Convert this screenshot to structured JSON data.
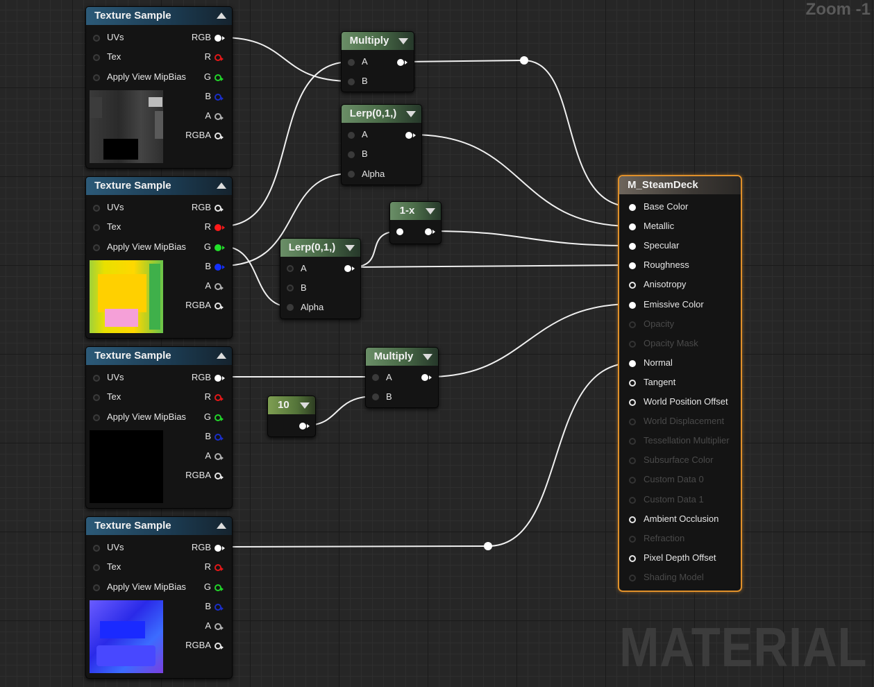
{
  "zoom_label": "Zoom -1",
  "watermark": "MATERIAL",
  "texture_nodes": [
    {
      "title": "Texture Sample",
      "inputs": [
        "UVs",
        "Tex",
        "Apply View MipBias"
      ],
      "outputs": [
        "RGB",
        "R",
        "G",
        "B",
        "A",
        "RGBA"
      ],
      "preview": "dark-gray-mask"
    },
    {
      "title": "Texture Sample",
      "inputs": [
        "UVs",
        "Tex",
        "Apply View MipBias"
      ],
      "outputs": [
        "RGB",
        "R",
        "G",
        "B",
        "A",
        "RGBA"
      ],
      "preview": "yellow-green-mask"
    },
    {
      "title": "Texture Sample",
      "inputs": [
        "UVs",
        "Tex",
        "Apply View MipBias"
      ],
      "outputs": [
        "RGB",
        "R",
        "G",
        "B",
        "A",
        "RGBA"
      ],
      "preview": "black"
    },
    {
      "title": "Texture Sample",
      "inputs": [
        "UVs",
        "Tex",
        "Apply View MipBias"
      ],
      "outputs": [
        "RGB",
        "R",
        "G",
        "B",
        "A",
        "RGBA"
      ],
      "preview": "blue-normal-map"
    }
  ],
  "multiply1": {
    "title": "Multiply",
    "inputs": [
      "A",
      "B"
    ]
  },
  "lerp1": {
    "title": "Lerp(0,1,)",
    "inputs": [
      "A",
      "B",
      "Alpha"
    ]
  },
  "one_minus": {
    "title": "1-x"
  },
  "lerp2": {
    "title": "Lerp(0,1,)",
    "inputs": [
      "A",
      "B",
      "Alpha"
    ]
  },
  "multiply2": {
    "title": "Multiply",
    "inputs": [
      "A",
      "B"
    ]
  },
  "constant": {
    "title": "10"
  },
  "material_node": {
    "title": "M_SteamDeck",
    "inputs": [
      {
        "label": "Base Color",
        "state": "connected"
      },
      {
        "label": "Metallic",
        "state": "connected"
      },
      {
        "label": "Specular",
        "state": "connected"
      },
      {
        "label": "Roughness",
        "state": "connected"
      },
      {
        "label": "Anisotropy",
        "state": "enabled"
      },
      {
        "label": "Emissive Color",
        "state": "connected"
      },
      {
        "label": "Opacity",
        "state": "disabled"
      },
      {
        "label": "Opacity Mask",
        "state": "disabled"
      },
      {
        "label": "Normal",
        "state": "connected"
      },
      {
        "label": "Tangent",
        "state": "enabled"
      },
      {
        "label": "World Position Offset",
        "state": "enabled"
      },
      {
        "label": "World Displacement",
        "state": "disabled"
      },
      {
        "label": "Tessellation Multiplier",
        "state": "disabled"
      },
      {
        "label": "Subsurface Color",
        "state": "disabled"
      },
      {
        "label": "Custom Data 0",
        "state": "disabled"
      },
      {
        "label": "Custom Data 1",
        "state": "disabled"
      },
      {
        "label": "Ambient Occlusion",
        "state": "enabled"
      },
      {
        "label": "Refraction",
        "state": "disabled"
      },
      {
        "label": "Pixel Depth Offset",
        "state": "enabled"
      },
      {
        "label": "Shading Model",
        "state": "disabled"
      }
    ]
  },
  "colors": {
    "texture_header": "#2c5a78",
    "math_header": "#6a8e67",
    "material_border": "#e0902a",
    "wire": "#ffffff",
    "pin_red": "#ff1a1a",
    "pin_green": "#22e02a",
    "pin_blue": "#1430ff"
  }
}
